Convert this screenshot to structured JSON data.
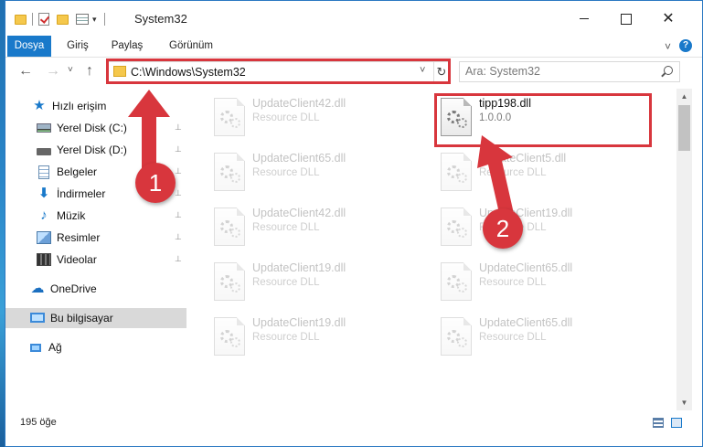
{
  "window": {
    "title": "System32",
    "quick_access_icons": [
      "folder-icon",
      "properties-check-icon",
      "new-folder-icon",
      "view-props-icon",
      "customize-dropdown-icon"
    ],
    "controls": {
      "minimize": "",
      "maximize": "",
      "close": "✕"
    }
  },
  "ribbon": {
    "tabs": [
      {
        "label": "Dosya",
        "active": true
      },
      {
        "label": "Giriş"
      },
      {
        "label": "Paylaş"
      },
      {
        "label": "Görünüm"
      }
    ],
    "expand_glyph": "˅",
    "help_glyph": "?"
  },
  "nav": {
    "back_glyph": "←",
    "forward_glyph": "→",
    "recent_glyph": "˅",
    "up_glyph": "↑",
    "address_path": "C:\\Windows\\System32",
    "address_dropdown_glyph": "˅",
    "refresh_glyph": "↻",
    "search_placeholder": "Ara: System32"
  },
  "sidebar": {
    "quick_access": {
      "label": "Hızlı erişim",
      "items": [
        {
          "label": "Yerel Disk (C:)",
          "icon": "local-disk-icon",
          "pinned": true
        },
        {
          "label": "Yerel Disk (D:)",
          "icon": "drive-icon",
          "pinned": true
        },
        {
          "label": "Belgeler",
          "icon": "documents-icon",
          "pinned": true
        },
        {
          "label": "İndirmeler",
          "icon": "downloads-icon",
          "pinned": true
        },
        {
          "label": "Müzik",
          "icon": "music-icon",
          "pinned": true
        },
        {
          "label": "Resimler",
          "icon": "pictures-icon",
          "pinned": true
        },
        {
          "label": "Videolar",
          "icon": "videos-icon",
          "pinned": true
        }
      ]
    },
    "onedrive": "OneDrive",
    "this_pc": "Bu bilgisayar",
    "network": "Ağ",
    "pin_glyph": "📌"
  },
  "files": {
    "left_column": [
      {
        "name": "UpdateClient42.dll",
        "desc": "Resource DLL"
      },
      {
        "name": "UpdateClient65.dll",
        "desc": "Resource DLL"
      },
      {
        "name": "UpdateClient42.dll",
        "desc": "Resource DLL"
      },
      {
        "name": "UpdateClient19.dll",
        "desc": "Resource DLL"
      },
      {
        "name": "UpdateClient19.dll",
        "desc": "Resource DLL"
      }
    ],
    "target": {
      "name": "tipp198.dll",
      "desc": "1.0.0.0"
    },
    "right_column": [
      {
        "name": "UpdateClient5.dll",
        "desc": "Resource DLL"
      },
      {
        "name": "UpdateClient19.dll",
        "desc": "Resource DLL"
      },
      {
        "name": "UpdateClient65.dll",
        "desc": "Resource DLL"
      },
      {
        "name": "UpdateClient65.dll",
        "desc": "Resource DLL"
      }
    ]
  },
  "scrollbar": {
    "up_glyph": "▲",
    "down_glyph": "▼"
  },
  "status": {
    "item_count": "195 öğe"
  },
  "annotations": {
    "badge_1": "1",
    "badge_2": "2",
    "highlight_color": "#d8363d"
  }
}
